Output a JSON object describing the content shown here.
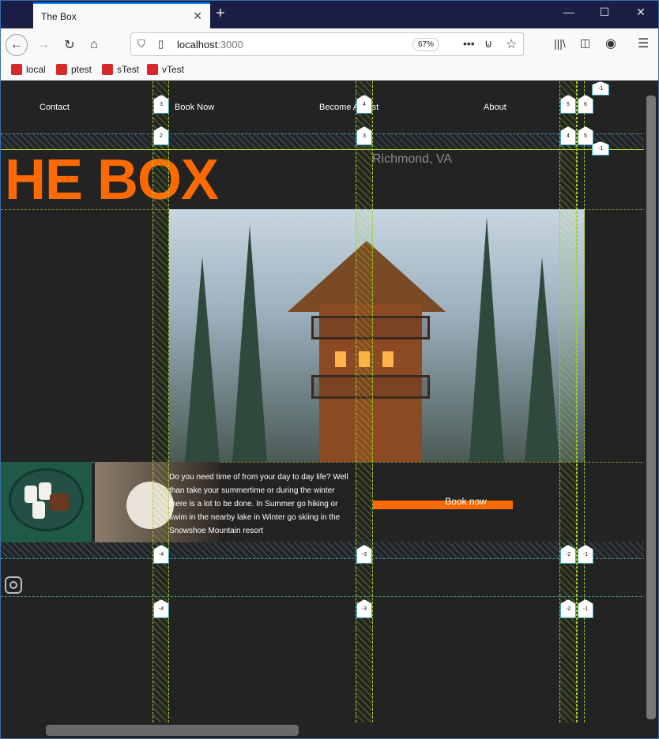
{
  "browser": {
    "tab_title": "The Box",
    "url_host": "localhost",
    "url_port": ":3000",
    "zoom": "67%",
    "bookmarks": [
      "local",
      "ptest",
      "sTest",
      "vTest"
    ]
  },
  "site": {
    "nav": [
      "Contact",
      "Book Now",
      "Become A Host",
      "About"
    ],
    "title": "HE BOX",
    "location": "Richmond, VA",
    "description": "Do you need time of from your day to day life? Well than take your summertime or during the winter there is a lot to be done. In Summer go hiking or swim in the nearby lake in Winter go skiing in the Snowshoe Mountain resort",
    "cta": "Book now"
  },
  "grid_markers": {
    "top_row": [
      "3",
      "4",
      "5",
      "6"
    ],
    "second_row": [
      "2",
      "3",
      "4",
      "5"
    ],
    "right_markers": [
      "-1",
      "-1"
    ],
    "bottom_row_1": [
      "-4",
      "-3",
      "-2",
      "-1"
    ],
    "bottom_row_2": [
      "-4",
      "-3",
      "-2",
      "-1"
    ]
  },
  "colors": {
    "accent": "#ff6a00",
    "background": "#232323",
    "grid": "#9fd12a"
  }
}
